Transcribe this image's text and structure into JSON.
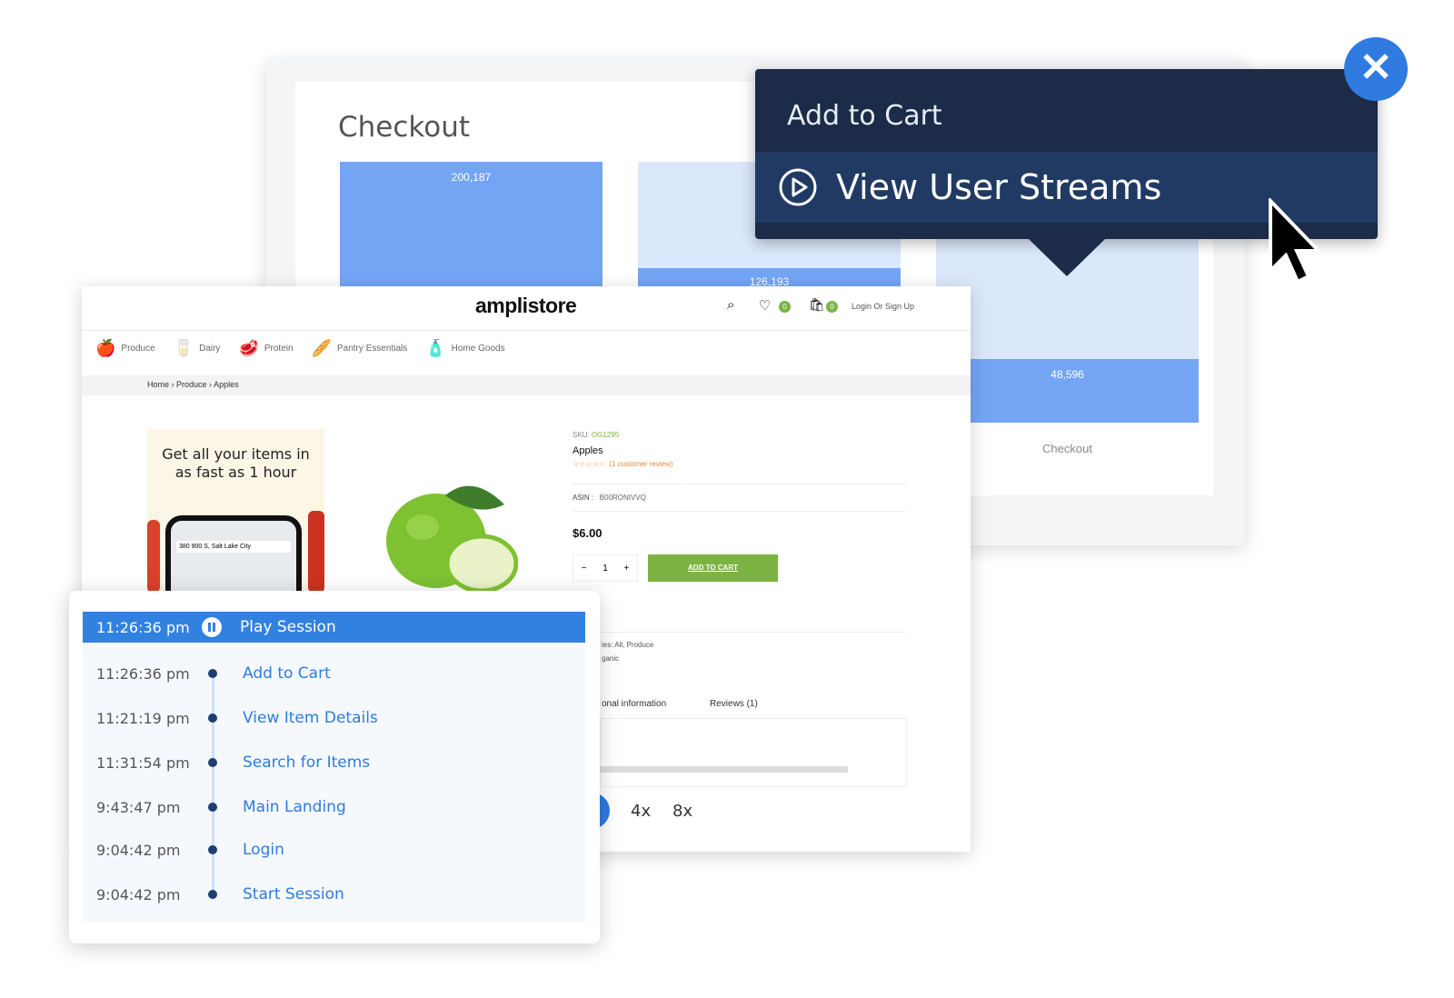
{
  "funnel": {
    "title": "Checkout",
    "bars": [
      {
        "value": "200,187"
      },
      {
        "value": "126,193"
      },
      {
        "value": "48,596",
        "label": "Checkout"
      }
    ],
    "colors": {
      "dark": "#74a5f5",
      "light": "#dbe8fb"
    }
  },
  "menu": {
    "item1": "Add to Cart",
    "item2": "View User Streams",
    "play_icon": "play-circle-icon",
    "close_icon": "close-icon",
    "bg": "#1b2b48"
  },
  "store": {
    "logo": "amplistore",
    "wishlist_count": "0",
    "cart_count": "0",
    "login": "Login Or Sign Up",
    "nav": [
      "Produce",
      "Dairy",
      "Protein",
      "Pantry Essentials",
      "Home Goods"
    ],
    "breadcrumb": [
      "Home",
      "Produce",
      "Apples"
    ],
    "banner": {
      "headline": "Get all your items in as fast as 1 hour",
      "address": "380 900 S, Salt Lake City"
    },
    "product": {
      "sku_label": "SKU:",
      "sku": "OG1295",
      "name": "Apples",
      "stars": "☆☆☆☆☆",
      "reviews": "(1 customer review)",
      "asin_label": "ASIN :",
      "asin": "B00RONIVVQ",
      "price": "$6.00",
      "qty": "1",
      "minus": "−",
      "plus": "+",
      "add_to_cart": "ADD TO CART",
      "categories": "ies:  All, Produce",
      "tags": "ganic",
      "tab_info": "onal information",
      "tab_reviews": "Reviews (1)"
    },
    "speeds": [
      "4x",
      "8x"
    ],
    "accent": "#7cb342"
  },
  "session": {
    "header": {
      "time": "11:26:36 pm",
      "label": "Play Session"
    },
    "events": [
      {
        "time": "11:26:36 pm",
        "label": "Add to Cart"
      },
      {
        "time": "11:21:19 pm",
        "label": "View Item Details"
      },
      {
        "time": "11:31:54 pm",
        "label": "Search for Items"
      },
      {
        "time": "9:43:47 pm",
        "label": "Main Landing"
      },
      {
        "time": "9:04:42 pm",
        "label": "Login"
      },
      {
        "time": "9:04:42 pm",
        "label": "Start Session"
      }
    ],
    "accent": "#3181e0"
  }
}
